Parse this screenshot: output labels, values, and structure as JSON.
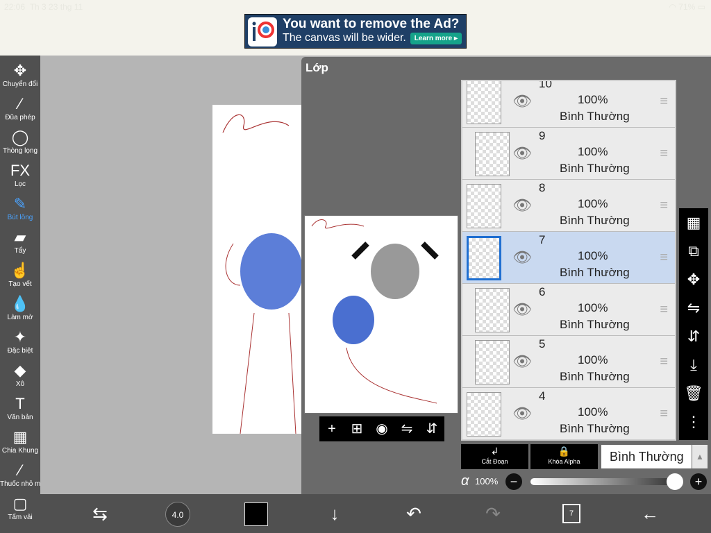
{
  "status": {
    "time": "22:06",
    "date": "Th 3 23 thg 11",
    "battery": "71%"
  },
  "ad": {
    "headline": "You want to remove the Ad?",
    "subline": "The canvas will be wider.",
    "button": "Learn more ▸",
    "logo_text": "ip"
  },
  "tools": [
    {
      "label": "Chuyển đổi",
      "icon": "move-icon"
    },
    {
      "label": "Đũa phép",
      "icon": "magic-wand-icon"
    },
    {
      "label": "Thòng lọng",
      "icon": "lasso-icon"
    },
    {
      "label": "Lọc",
      "icon": "fx-icon"
    },
    {
      "label": "Bút lông",
      "icon": "brush-icon"
    },
    {
      "label": "Tẩy",
      "icon": "eraser-icon"
    },
    {
      "label": "Tạo vết",
      "icon": "smudge-icon"
    },
    {
      "label": "Làm mờ",
      "icon": "blur-icon"
    },
    {
      "label": "Đặc biệt",
      "icon": "special-icon"
    },
    {
      "label": "Xô",
      "icon": "bucket-icon"
    },
    {
      "label": "Văn bản",
      "icon": "text-icon"
    },
    {
      "label": "Chia Khung",
      "icon": "frame-divider-icon"
    },
    {
      "label": "Thuốc nhỏ mắt",
      "icon": "eyedropper-icon"
    },
    {
      "label": "Tấm vải",
      "icon": "canvas-icon"
    }
  ],
  "tool_glyphs": [
    "✥",
    "⁄",
    "◯",
    "FX",
    "✎",
    "▰",
    "☝",
    "💧",
    "✦",
    "◆",
    "T",
    "▦",
    "⁄",
    "▢"
  ],
  "active_tool": "Bút lông",
  "panel": {
    "title": "Lớp"
  },
  "layers": [
    {
      "num": "10",
      "opacity": "100%",
      "blend": "Bình Thường"
    },
    {
      "num": "9",
      "opacity": "100%",
      "blend": "Bình Thường"
    },
    {
      "num": "8",
      "opacity": "100%",
      "blend": "Bình Thường"
    },
    {
      "num": "7",
      "opacity": "100%",
      "blend": "Bình Thường"
    },
    {
      "num": "6",
      "opacity": "100%",
      "blend": "Bình Thường"
    },
    {
      "num": "5",
      "opacity": "100%",
      "blend": "Bình Thường"
    },
    {
      "num": "4",
      "opacity": "100%",
      "blend": "Bình Thường"
    }
  ],
  "selected_layer": "7",
  "clip_button": "Cắt Đoạn",
  "alpha_lock_button": "Khóa Alpha",
  "blend_mode": "Bình Thường",
  "alpha": {
    "symbol": "α",
    "value": "100%"
  },
  "brush_size": "4.0",
  "layer_count": "7",
  "colors": {
    "accent": "#1f6fd1",
    "active_tool": "#4aa3ff",
    "selected_layer_bg": "#c9d9f0",
    "primary_color": "#000000"
  }
}
